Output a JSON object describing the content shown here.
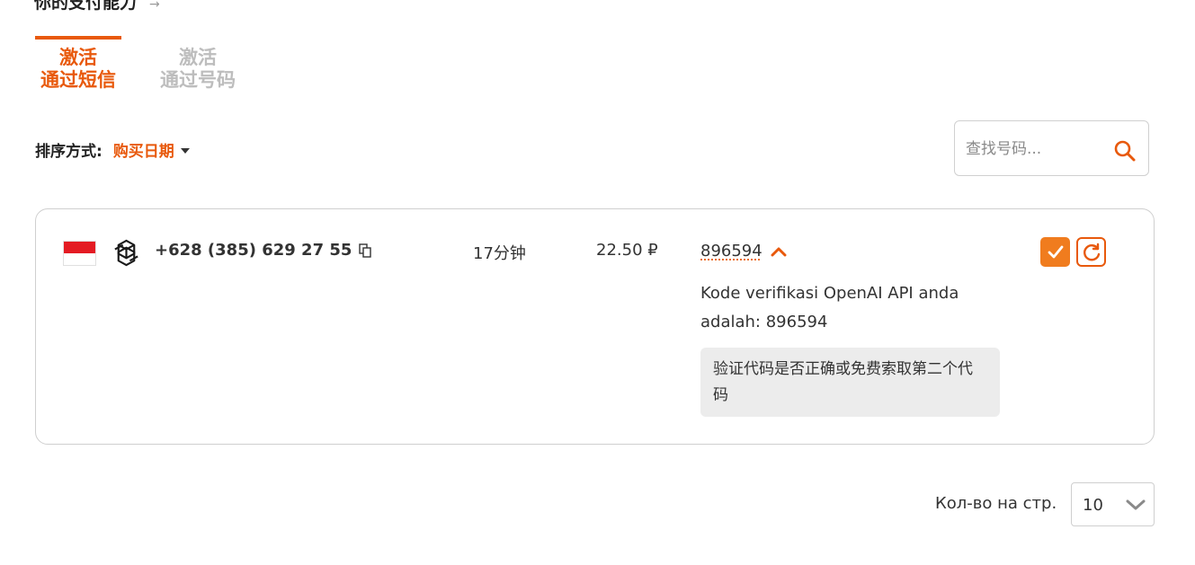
{
  "section_title": "你的支付能力",
  "tabs": [
    {
      "label": "激活\n通过短信",
      "active": true
    },
    {
      "label": "激活\n通过号码",
      "active": false
    }
  ],
  "sort": {
    "label": "排序方式:",
    "value": "购买日期"
  },
  "search": {
    "placeholder": "查找号码..."
  },
  "activation": {
    "country_flag": "indonesia-flag",
    "service_icon": "openai-icon",
    "phone": "+628 (385) 629 27 55",
    "duration": "17分钟",
    "price": "22.50 ₽",
    "code": "896594",
    "sms_text": "Kode verifikasi OpenAI API anda adalah: 896594",
    "hint": "验证代码是否正确或免费索取第二个代码"
  },
  "pagination": {
    "label": "Кол-во на стр.",
    "value": "10"
  },
  "colors": {
    "accent": "#e8590c",
    "button": "#f07c1e",
    "hint_bg": "#ececec"
  }
}
